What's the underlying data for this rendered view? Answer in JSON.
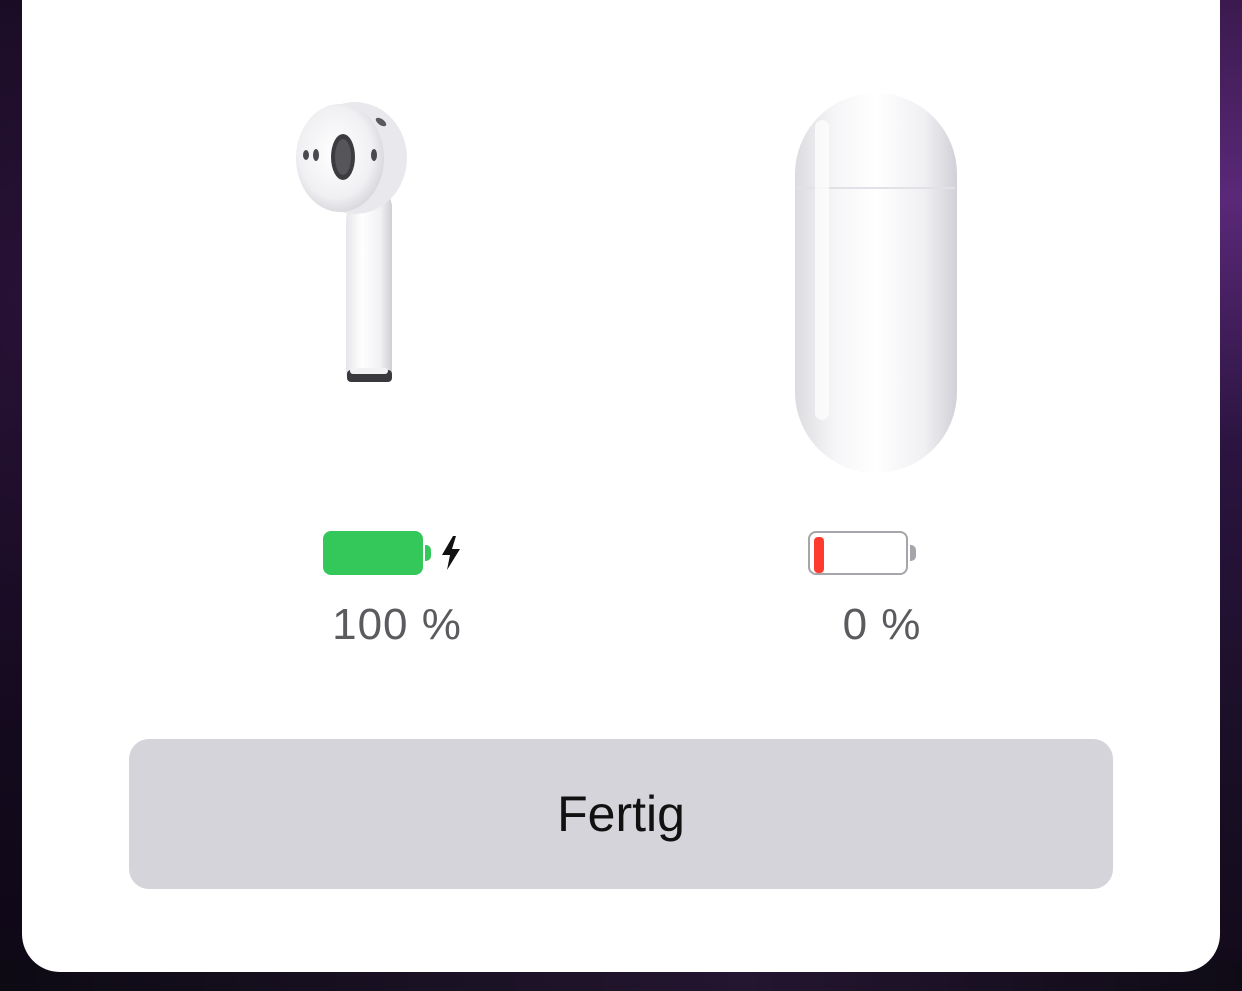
{
  "devices": [
    {
      "id": "earbud",
      "icon": "airpod-earbud-icon",
      "battery_percent_label": "100 %",
      "battery_level": 1.0,
      "charging": true,
      "battery_color": "#34c759"
    },
    {
      "id": "case",
      "icon": "airpods-case-icon",
      "battery_percent_label": "0 %",
      "battery_level": 0.0,
      "charging": false,
      "battery_color": "#ff3b30"
    }
  ],
  "actions": {
    "done_label": "Fertig"
  },
  "colors": {
    "button_background": "#d4d4da",
    "card_background": "#ffffff",
    "percent_text": "#5a5a5f"
  }
}
